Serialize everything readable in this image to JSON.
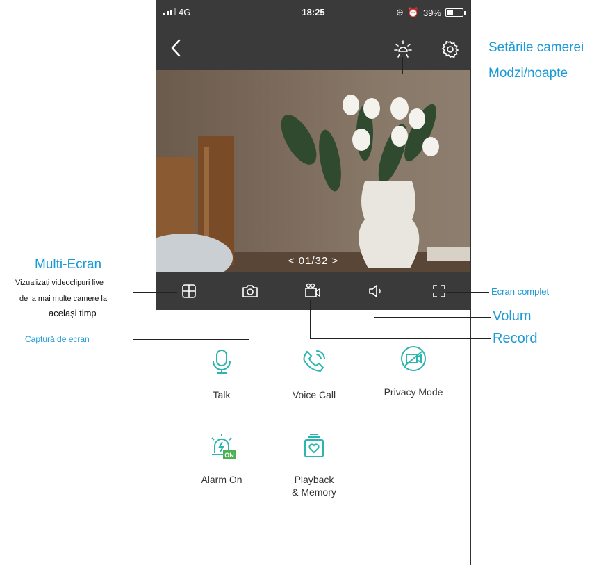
{
  "status": {
    "carrier": "4G",
    "time": "18:25",
    "battery": "39%",
    "battery_level": 0.39
  },
  "video": {
    "counter": "<  01/32  >"
  },
  "functions": [
    {
      "label": "Talk"
    },
    {
      "label": "Voice Call"
    },
    {
      "label": "Privacy Mode"
    },
    {
      "label": "Alarm On",
      "badge": "ON"
    },
    {
      "label": "Playback\n& Memory"
    }
  ],
  "annotations": {
    "camera_settings": "Setările camerei",
    "day_night": "Modzi/noapte",
    "multi_screen_title": "Multi-Ecran",
    "multi_screen_desc_1": "Vizualizați videoclipuri live",
    "multi_screen_desc_2": "de la mai multe camere la",
    "multi_screen_desc_3": "același timp",
    "full_screen": "Ecran complet",
    "volume": "Volum",
    "record": "Record",
    "screenshot": "Captură de ecran"
  },
  "colors": {
    "accent": "#2bb5b1",
    "annotation": "#1a9ad6",
    "bar": "#3a3a3a"
  }
}
